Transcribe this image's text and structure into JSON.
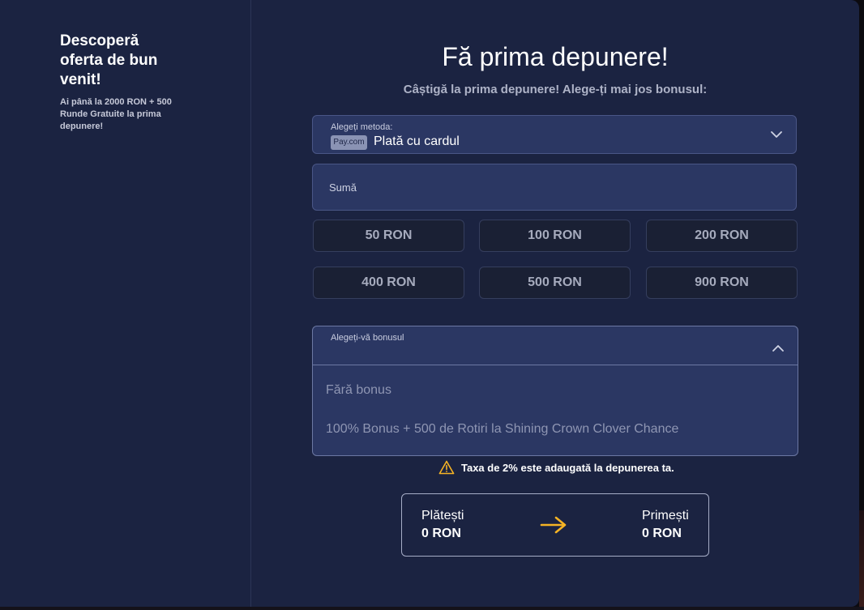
{
  "colors": {
    "modal_bg": "#1b2341",
    "field_bg": "#2b3763",
    "preset_bg": "#1a2034",
    "accent_arrow": "#f5b324",
    "warning": "#f5b324"
  },
  "sidebar": {
    "title": "Descoperă oferta de bun venit!",
    "description": "Ai până la 2000 RON + 500 Runde Gratuite la prima depunere!"
  },
  "main": {
    "title": "Fă prima depunere!",
    "subtitle": "Câștigă la prima depunere! Alege-ți mai jos bonusul:"
  },
  "method": {
    "label": "Alegeți metoda:",
    "badge": "Pay.com",
    "value": "Plată cu cardul",
    "chevron_icon": "chevron-down-icon"
  },
  "amount": {
    "placeholder": "Sumă"
  },
  "presets": [
    {
      "label": "50 RON"
    },
    {
      "label": "100 RON"
    },
    {
      "label": "200 RON"
    },
    {
      "label": "400 RON"
    },
    {
      "label": "500 RON"
    },
    {
      "label": "900 RON"
    }
  ],
  "bonus": {
    "label": "Alegeți-vă bonusul",
    "chevron_icon": "chevron-up-icon",
    "options": [
      {
        "label": "Fără bonus"
      },
      {
        "label": "100% Bonus + 500 de Rotiri la Shining Crown Clover Chance"
      }
    ]
  },
  "tax_note": {
    "icon": "warning-icon",
    "text": "Taxa de 2% este adaugată la depunerea ta."
  },
  "summary": {
    "pay_label": "Plătești",
    "pay_value": "0 RON",
    "arrow_icon": "arrow-right-icon",
    "receive_label": "Primești",
    "receive_value": "0 RON"
  }
}
